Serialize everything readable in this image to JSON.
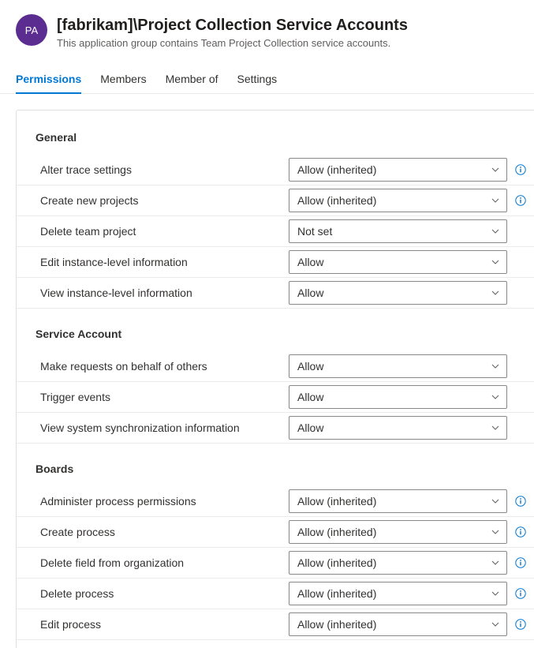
{
  "header": {
    "avatar_initials": "PA",
    "title": "[fabrikam]\\Project Collection Service Accounts",
    "subtitle": "This application group contains Team Project Collection service accounts."
  },
  "tabs": [
    {
      "label": "Permissions",
      "active": true
    },
    {
      "label": "Members",
      "active": false
    },
    {
      "label": "Member of",
      "active": false
    },
    {
      "label": "Settings",
      "active": false
    }
  ],
  "sections": [
    {
      "title": "General",
      "rows": [
        {
          "label": "Alter trace settings",
          "value": "Allow (inherited)",
          "info": true
        },
        {
          "label": "Create new projects",
          "value": "Allow (inherited)",
          "info": true
        },
        {
          "label": "Delete team project",
          "value": "Not set",
          "info": false
        },
        {
          "label": "Edit instance-level information",
          "value": "Allow",
          "info": false
        },
        {
          "label": "View instance-level information",
          "value": "Allow",
          "info": false
        }
      ]
    },
    {
      "title": "Service Account",
      "rows": [
        {
          "label": "Make requests on behalf of others",
          "value": "Allow",
          "info": false
        },
        {
          "label": "Trigger events",
          "value": "Allow",
          "info": false
        },
        {
          "label": "View system synchronization information",
          "value": "Allow",
          "info": false
        }
      ]
    },
    {
      "title": "Boards",
      "rows": [
        {
          "label": "Administer process permissions",
          "value": "Allow (inherited)",
          "info": true
        },
        {
          "label": "Create process",
          "value": "Allow (inherited)",
          "info": true
        },
        {
          "label": "Delete field from organization",
          "value": "Allow (inherited)",
          "info": true
        },
        {
          "label": "Delete process",
          "value": "Allow (inherited)",
          "info": true
        },
        {
          "label": "Edit process",
          "value": "Allow (inherited)",
          "info": true
        }
      ]
    }
  ]
}
